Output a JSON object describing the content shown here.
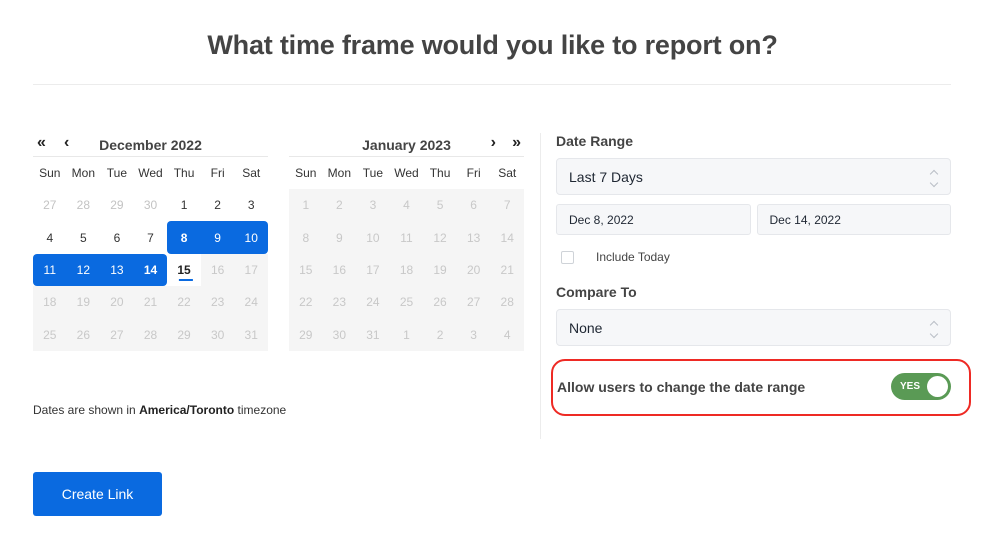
{
  "page": {
    "title": "What time frame would you like to report on?"
  },
  "calendar": {
    "weekdays": [
      "Sun",
      "Mon",
      "Tue",
      "Wed",
      "Thu",
      "Fri",
      "Sat"
    ],
    "nav": {
      "prev_year": "«",
      "prev_month": "‹",
      "next_month": "›",
      "next_year": "»"
    },
    "months": [
      {
        "title": "December 2022",
        "days": [
          {
            "d": "27",
            "state": "outside"
          },
          {
            "d": "28",
            "state": "outside"
          },
          {
            "d": "29",
            "state": "outside"
          },
          {
            "d": "30",
            "state": "outside"
          },
          {
            "d": "1",
            "state": "normal"
          },
          {
            "d": "2",
            "state": "normal"
          },
          {
            "d": "3",
            "state": "normal"
          },
          {
            "d": "4",
            "state": "normal"
          },
          {
            "d": "5",
            "state": "normal"
          },
          {
            "d": "6",
            "state": "normal"
          },
          {
            "d": "7",
            "state": "normal"
          },
          {
            "d": "8",
            "state": "range-start"
          },
          {
            "d": "9",
            "state": "in-range"
          },
          {
            "d": "10",
            "state": "in-range"
          },
          {
            "d": "11",
            "state": "in-range"
          },
          {
            "d": "12",
            "state": "in-range"
          },
          {
            "d": "13",
            "state": "in-range"
          },
          {
            "d": "14",
            "state": "range-end"
          },
          {
            "d": "15",
            "state": "today"
          },
          {
            "d": "16",
            "state": "disabled"
          },
          {
            "d": "17",
            "state": "disabled"
          },
          {
            "d": "18",
            "state": "disabled"
          },
          {
            "d": "19",
            "state": "disabled"
          },
          {
            "d": "20",
            "state": "disabled"
          },
          {
            "d": "21",
            "state": "disabled"
          },
          {
            "d": "22",
            "state": "disabled"
          },
          {
            "d": "23",
            "state": "disabled"
          },
          {
            "d": "24",
            "state": "disabled"
          },
          {
            "d": "25",
            "state": "disabled"
          },
          {
            "d": "26",
            "state": "disabled"
          },
          {
            "d": "27",
            "state": "disabled"
          },
          {
            "d": "28",
            "state": "disabled"
          },
          {
            "d": "29",
            "state": "disabled"
          },
          {
            "d": "30",
            "state": "disabled"
          },
          {
            "d": "31",
            "state": "disabled"
          }
        ]
      },
      {
        "title": "January 2023",
        "days": [
          {
            "d": "1",
            "state": "disabled"
          },
          {
            "d": "2",
            "state": "disabled"
          },
          {
            "d": "3",
            "state": "disabled"
          },
          {
            "d": "4",
            "state": "disabled"
          },
          {
            "d": "5",
            "state": "disabled"
          },
          {
            "d": "6",
            "state": "disabled"
          },
          {
            "d": "7",
            "state": "disabled"
          },
          {
            "d": "8",
            "state": "disabled"
          },
          {
            "d": "9",
            "state": "disabled"
          },
          {
            "d": "10",
            "state": "disabled"
          },
          {
            "d": "11",
            "state": "disabled"
          },
          {
            "d": "12",
            "state": "disabled"
          },
          {
            "d": "13",
            "state": "disabled"
          },
          {
            "d": "14",
            "state": "disabled"
          },
          {
            "d": "15",
            "state": "disabled"
          },
          {
            "d": "16",
            "state": "disabled"
          },
          {
            "d": "17",
            "state": "disabled"
          },
          {
            "d": "18",
            "state": "disabled"
          },
          {
            "d": "19",
            "state": "disabled"
          },
          {
            "d": "20",
            "state": "disabled"
          },
          {
            "d": "21",
            "state": "disabled"
          },
          {
            "d": "22",
            "state": "disabled"
          },
          {
            "d": "23",
            "state": "disabled"
          },
          {
            "d": "24",
            "state": "disabled"
          },
          {
            "d": "25",
            "state": "disabled"
          },
          {
            "d": "26",
            "state": "disabled"
          },
          {
            "d": "27",
            "state": "disabled"
          },
          {
            "d": "28",
            "state": "disabled"
          },
          {
            "d": "29",
            "state": "disabled"
          },
          {
            "d": "30",
            "state": "disabled"
          },
          {
            "d": "31",
            "state": "disabled"
          },
          {
            "d": "1",
            "state": "disabled"
          },
          {
            "d": "2",
            "state": "disabled"
          },
          {
            "d": "3",
            "state": "disabled"
          },
          {
            "d": "4",
            "state": "disabled"
          }
        ]
      }
    ],
    "timezone_note": {
      "prefix": "Dates are shown in ",
      "timezone": "America/Toronto",
      "suffix": " timezone"
    }
  },
  "settings": {
    "date_range_label": "Date Range",
    "date_range_value": "Last 7 Days",
    "start_date": "Dec 8, 2022",
    "end_date": "Dec 14, 2022",
    "include_today_label": "Include Today",
    "include_today_checked": false,
    "compare_to_label": "Compare To",
    "compare_to_value": "None",
    "allow_change_label": "Allow users to change the date range",
    "allow_change_toggle": "YES",
    "allow_change_enabled": true
  },
  "actions": {
    "create_link": "Create Link"
  },
  "colors": {
    "accent": "#0a6ae0",
    "toggle_on": "#5a9a55",
    "highlight": "#ee2a24"
  }
}
